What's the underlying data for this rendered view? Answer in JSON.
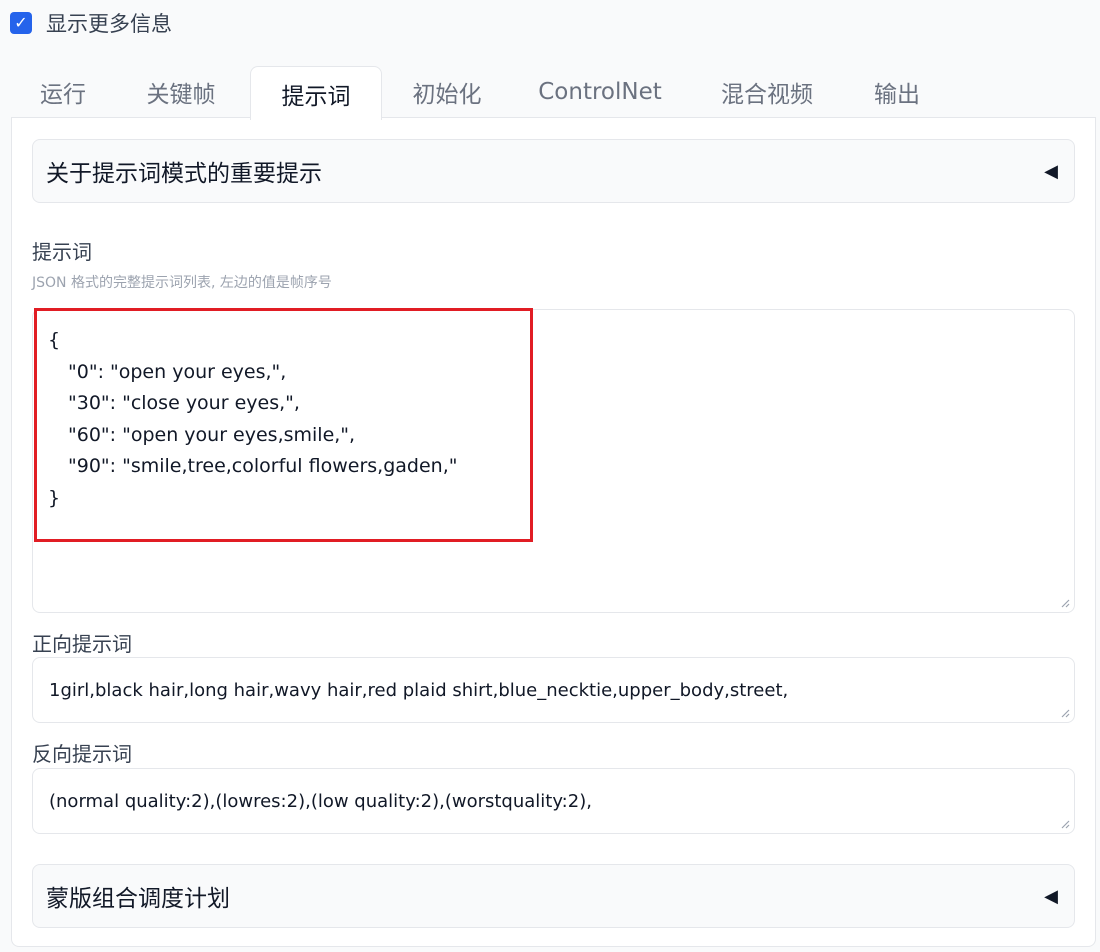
{
  "top_checkbox": {
    "label": "显示更多信息",
    "checked": true
  },
  "tabs": [
    {
      "label": "运行"
    },
    {
      "label": "关键帧"
    },
    {
      "label": "提示词",
      "active": true
    },
    {
      "label": "初始化"
    },
    {
      "label": "ControlNet"
    },
    {
      "label": "混合视频"
    },
    {
      "label": "输出"
    }
  ],
  "accordion_top": {
    "title": "关于提示词模式的重要提示",
    "arrow": "◀"
  },
  "prompts": {
    "label": "提示词",
    "info": "JSON 格式的完整提示词列表, 左边的值是帧序号",
    "lines": [
      "{",
      "\"0\": \"open your eyes,\",",
      "\"30\": \"close your eyes,\",",
      "\"60\": \"open your eyes,smile,\",",
      "\"90\": \"smile,tree,colorful flowers,gaden,\"",
      "}"
    ]
  },
  "positive": {
    "label": "正向提示词",
    "value": "1girl,black hair,long hair,wavy hair,red plaid shirt,blue_necktie,upper_body,street,"
  },
  "negative": {
    "label": "反向提示词",
    "value": "(normal quality:2),(lowres:2),(low quality:2),(worstquality:2),"
  },
  "accordion_bottom": {
    "title": "蒙版组合调度计划",
    "arrow": "◀"
  },
  "colors": {
    "accent": "#2563eb",
    "highlight_box": "#e11d24"
  }
}
